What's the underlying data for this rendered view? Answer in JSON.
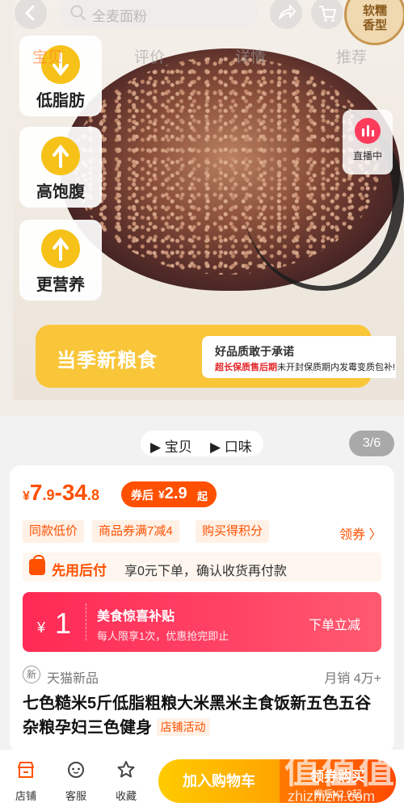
{
  "search": {
    "placeholder": "全麦面粉"
  },
  "seal": {
    "line1": "软糯",
    "line2": "香型"
  },
  "tabs": [
    "宝贝",
    "评价",
    "详情",
    "推荐"
  ],
  "features": [
    "低脂肪",
    "高饱腹",
    "更营养"
  ],
  "live": {
    "label": "直播中"
  },
  "banner": {
    "main": "当季新粮食",
    "promise": "好品质敢于承诺",
    "note_red": "超长保质售后期",
    "note_rest": "未开封保质期内发霉变质包补!"
  },
  "media_switch": {
    "item1": "宝贝",
    "item2": "口味"
  },
  "media_counter": "3/6",
  "price": {
    "currency": "¥",
    "low_int": "7",
    "low_dec": ".9",
    "dash": "-",
    "high_int": "34",
    "high_dec": ".8"
  },
  "coupon": {
    "label": "券后",
    "currency": "¥",
    "value": "2.9",
    "suffix": "起"
  },
  "tags": [
    "同款低价",
    "商品券满7减4",
    "购买得积分"
  ],
  "claim": "领券 〉",
  "pay_later": {
    "title": "先用后付",
    "desc": "享0元下单，确认收货再付款"
  },
  "subsidy": {
    "currency": "¥",
    "amount": "1",
    "title": "美食惊喜补贴",
    "subtitle": "每人限享1次，优惠抢完即止",
    "button": "下单立减"
  },
  "store": {
    "icon": "新",
    "name": "天猫新品",
    "sales": "月销 4万+"
  },
  "title": {
    "text": "七色糙米5斤低脂粗粮大米黑米主食饭新五色五谷杂粮孕妇三色健身",
    "tag": "店铺活动"
  },
  "bottom_nav": [
    "店铺",
    "客服",
    "收藏"
  ],
  "cta": {
    "add_cart": "加入购物车",
    "buy": "领券购买",
    "buy_sub": "券后¥2.9起"
  },
  "watermark": {
    "big": "值值值",
    "small": "zhizhizhi.com"
  },
  "colors": {
    "accent": "#ff5000",
    "subsidy": "#ff2a55",
    "banner": "#f9c63a"
  }
}
